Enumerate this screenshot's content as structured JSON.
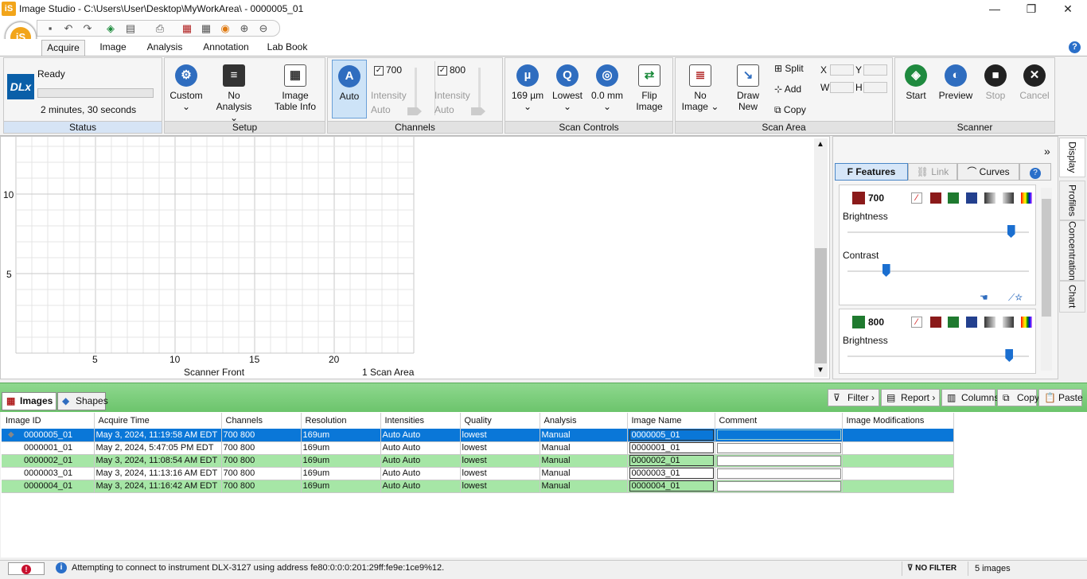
{
  "window": {
    "title": "Image Studio - C:\\Users\\User\\Desktop\\MyWorkArea\\ - 0000005_01",
    "app_icon": "iS",
    "minimize": "—",
    "maximize": "❐",
    "close": "✕"
  },
  "orb": "iS",
  "tabs": [
    "Acquire",
    "Image",
    "Analysis",
    "Annotation",
    "Lab Book"
  ],
  "ribbon": {
    "status": {
      "logo": "DLx",
      "state": "Ready",
      "time": "2 minutes, 30 seconds",
      "label": "Status"
    },
    "setup": {
      "custom": "Custom",
      "no_analysis_1": "No",
      "no_analysis_2": "Analysis",
      "image_table_1": "Image",
      "image_table_2": "Table Info",
      "label": "Setup"
    },
    "channels": {
      "auto": "Auto",
      "ch1": "700",
      "ch2": "800",
      "intensity": "Intensity",
      "intensity_auto": "Auto",
      "label": "Channels"
    },
    "scan_controls": {
      "resolution": "169 µm",
      "quality": "Lowest",
      "focus": "0.0 mm",
      "flip_1": "Flip",
      "flip_2": "Image",
      "label": "Scan Controls",
      "icon_res": "µ",
      "icon_q": "Q"
    },
    "scan_area": {
      "no_image_1": "No",
      "no_image_2": "Image",
      "draw_1": "Draw",
      "draw_2": "New",
      "split": "Split",
      "add": "Add",
      "copy": "Copy",
      "x": "X",
      "y": "Y",
      "w": "W",
      "h": "H",
      "label": "Scan Area"
    },
    "scanner": {
      "start": "Start",
      "preview": "Preview",
      "stop": "Stop",
      "cancel": "Cancel",
      "label": "Scanner"
    }
  },
  "plot": {
    "y_ticks": [
      "10",
      "5"
    ],
    "x_ticks": [
      "5",
      "10",
      "15",
      "20"
    ],
    "front_label": "Scanner Front",
    "area_label": "1 Scan Area"
  },
  "side_panel": {
    "tabs": [
      "Features",
      "Link",
      "Curves"
    ],
    "vtabs": [
      "Display",
      "Profiles",
      "Concentration",
      "Chart"
    ],
    "ch700": {
      "name": "700",
      "brightness": "Brightness",
      "contrast": "Contrast",
      "brightness_level": 0.92,
      "contrast_level": 0.2
    },
    "ch800": {
      "name": "800",
      "brightness": "Brightness",
      "brightness_level": 0.91
    }
  },
  "images_bar": {
    "tab_images": "Images",
    "tab_shapes": "Shapes",
    "filter": "Filter",
    "report": "Report",
    "columns": "Columns",
    "copy": "Copy",
    "paste": "Paste"
  },
  "table": {
    "columns": [
      "Image ID",
      "Acquire Time",
      "Channels",
      "Resolution",
      "Intensities",
      "Quality",
      "Analysis",
      "Image Name",
      "Comment",
      "Image Modifications"
    ],
    "rows": [
      [
        "0000005_01",
        "May 3, 2024, 11:19:58 AM EDT",
        "700 800",
        "169um",
        "Auto Auto",
        "lowest",
        "Manual",
        "0000005_01"
      ],
      [
        "0000001_01",
        "May 2, 2024, 5:47:05 PM EDT",
        "700 800",
        "169um",
        "Auto Auto",
        "lowest",
        "Manual",
        "0000001_01"
      ],
      [
        "0000002_01",
        "May 3, 2024, 11:08:54 AM EDT",
        "700 800",
        "169um",
        "Auto Auto",
        "lowest",
        "Manual",
        "0000002_01"
      ],
      [
        "0000003_01",
        "May 3, 2024, 11:13:16 AM EDT",
        "700 800",
        "169um",
        "Auto Auto",
        "lowest",
        "Manual",
        "0000003_01"
      ],
      [
        "0000004_01",
        "May 3, 2024, 11:16:42 AM EDT",
        "700 800",
        "169um",
        "Auto Auto",
        "lowest",
        "Manual",
        "0000004_01"
      ]
    ]
  },
  "status_bar": {
    "message": "Attempting to connect to instrument DLX-3127 using address fe80:0:0:0:201:29ff:fe9e:1ce9%12.",
    "filter": "NO FILTER",
    "count": "5 images"
  }
}
